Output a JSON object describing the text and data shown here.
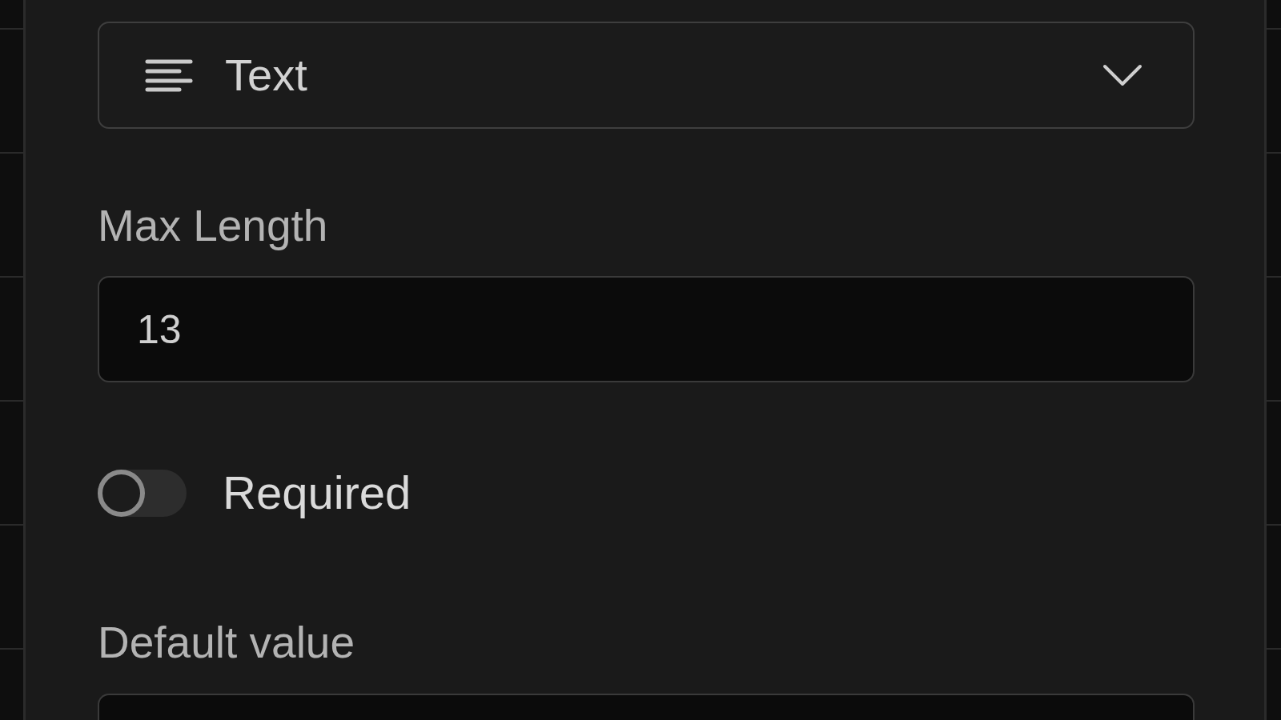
{
  "field_type": {
    "value": "Text"
  },
  "fields": [
    {
      "kind": "input",
      "label": "Max Length",
      "value": "13"
    },
    {
      "kind": "toggle",
      "label": "Required",
      "on": false
    },
    {
      "kind": "input",
      "label": "Default value"
    }
  ]
}
